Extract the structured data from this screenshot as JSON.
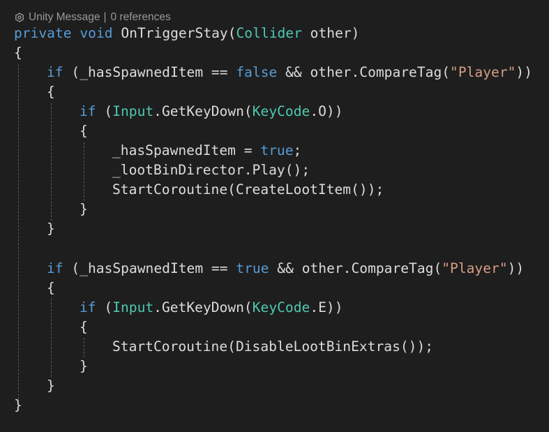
{
  "codelens": {
    "icon": "gear-icon",
    "unity_message": "Unity Message",
    "separator": "|",
    "references": "0 references"
  },
  "code": {
    "l01": {
      "t1": "private",
      "t2": " ",
      "t3": "void",
      "t4": " OnTriggerStay(",
      "t5": "Collider",
      "t6": " other)"
    },
    "l02": {
      "t1": "{"
    },
    "l03": {
      "t1": "if",
      "t2": " (_hasSpawnedItem == ",
      "t3": "false",
      "t4": " && other.CompareTag(",
      "t5": "\"Player\"",
      "t6": "))"
    },
    "l04": {
      "t1": "{"
    },
    "l05": {
      "t1": "if",
      "t2": " (",
      "t3": "Input",
      "t4": ".GetKeyDown(",
      "t5": "KeyCode",
      "t6": ".O))"
    },
    "l06": {
      "t1": "{"
    },
    "l07": {
      "t1": "_hasSpawnedItem = ",
      "t2": "true",
      "t3": ";"
    },
    "l08": {
      "t1": "_lootBinDirector.Play();"
    },
    "l09": {
      "t1": "StartCoroutine(CreateLootItem());"
    },
    "l10": {
      "t1": "}"
    },
    "l11": {
      "t1": "}"
    },
    "l13": {
      "t1": "if",
      "t2": " (_hasSpawnedItem == ",
      "t3": "true",
      "t4": " && other.CompareTag(",
      "t5": "\"Player\"",
      "t6": "))"
    },
    "l14": {
      "t1": "{"
    },
    "l15": {
      "t1": "if",
      "t2": " (",
      "t3": "Input",
      "t4": ".GetKeyDown(",
      "t5": "KeyCode",
      "t6": ".E))"
    },
    "l16": {
      "t1": "{"
    },
    "l17": {
      "t1": "StartCoroutine(DisableLootBinExtras());"
    },
    "l18": {
      "t1": "}"
    },
    "l19": {
      "t1": "}"
    },
    "l20": {
      "t1": "}"
    }
  },
  "colors": {
    "background": "#1e1e1e",
    "keyword": "#569cd6",
    "type": "#4ec9b0",
    "string": "#d69d85",
    "plain": "#dcdcdc",
    "codelens": "#999999"
  }
}
